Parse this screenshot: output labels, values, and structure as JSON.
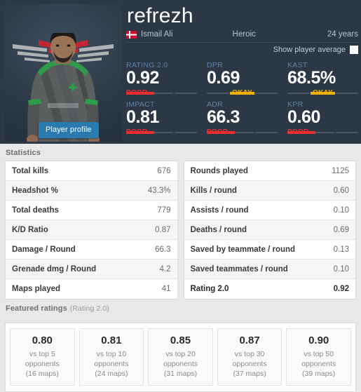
{
  "player": {
    "nickname": "refrezh",
    "real_name": "Ismail Ali",
    "team": "Heroic",
    "age": "24 years",
    "country": "denmark-flag",
    "profile_button": "Player profile",
    "show_average_label": "Show player average"
  },
  "header_stats": [
    {
      "label": "RATING 2.0",
      "value": "0.92",
      "verdict": "POOR",
      "verdict_color": "#eb2d2d"
    },
    {
      "label": "DPR",
      "value": "0.69",
      "verdict": "OKAY",
      "verdict_color": "#f0b000"
    },
    {
      "label": "KAST",
      "value": "68.5%",
      "verdict": "OKAY",
      "verdict_color": "#f0b000"
    },
    {
      "label": "IMPACT",
      "value": "0.81",
      "verdict": "POOR",
      "verdict_color": "#eb2d2d"
    },
    {
      "label": "ADR",
      "value": "66.3",
      "verdict": "POOR",
      "verdict_color": "#eb2d2d"
    },
    {
      "label": "KPR",
      "value": "0.60",
      "verdict": "POOR",
      "verdict_color": "#eb2d2d"
    }
  ],
  "statistics": {
    "title": "Statistics",
    "left": [
      {
        "key": "Total kills",
        "value": "676"
      },
      {
        "key": "Headshot %",
        "value": "43.3%"
      },
      {
        "key": "Total deaths",
        "value": "779"
      },
      {
        "key": "K/D Ratio",
        "value": "0.87"
      },
      {
        "key": "Damage / Round",
        "value": "66.3"
      },
      {
        "key": "Grenade dmg / Round",
        "value": "4.2"
      },
      {
        "key": "Maps played",
        "value": "41"
      }
    ],
    "right": [
      {
        "key": "Rounds played",
        "value": "1125"
      },
      {
        "key": "Kills / round",
        "value": "0.60"
      },
      {
        "key": "Assists / round",
        "value": "0.10"
      },
      {
        "key": "Deaths / round",
        "value": "0.69"
      },
      {
        "key": "Saved by teammate / round",
        "value": "0.13"
      },
      {
        "key": "Saved teammates / round",
        "value": "0.10"
      },
      {
        "key": "Rating 2.0",
        "value": "0.92"
      }
    ]
  },
  "featured_ratings": {
    "title": "Featured ratings",
    "subtitle": "(Rating 2.0)",
    "cards": [
      {
        "value": "0.80",
        "line1": "vs top 5",
        "line2": "opponents",
        "line3": "(16 maps)"
      },
      {
        "value": "0.81",
        "line1": "vs top 10",
        "line2": "opponents",
        "line3": "(24 maps)"
      },
      {
        "value": "0.85",
        "line1": "vs top 20",
        "line2": "opponents",
        "line3": "(31 maps)"
      },
      {
        "value": "0.87",
        "line1": "vs top 30",
        "line2": "opponents",
        "line3": "(37 maps)"
      },
      {
        "value": "0.90",
        "line1": "vs top 50",
        "line2": "opponents",
        "line3": "(39 maps)"
      }
    ]
  },
  "colors": {
    "header_bg": "#2d3846",
    "accent_blue": "#2a7ab0",
    "label_blue": "#5d83a8",
    "poor_red": "#eb2d2d",
    "okay_yellow": "#f0b000"
  }
}
